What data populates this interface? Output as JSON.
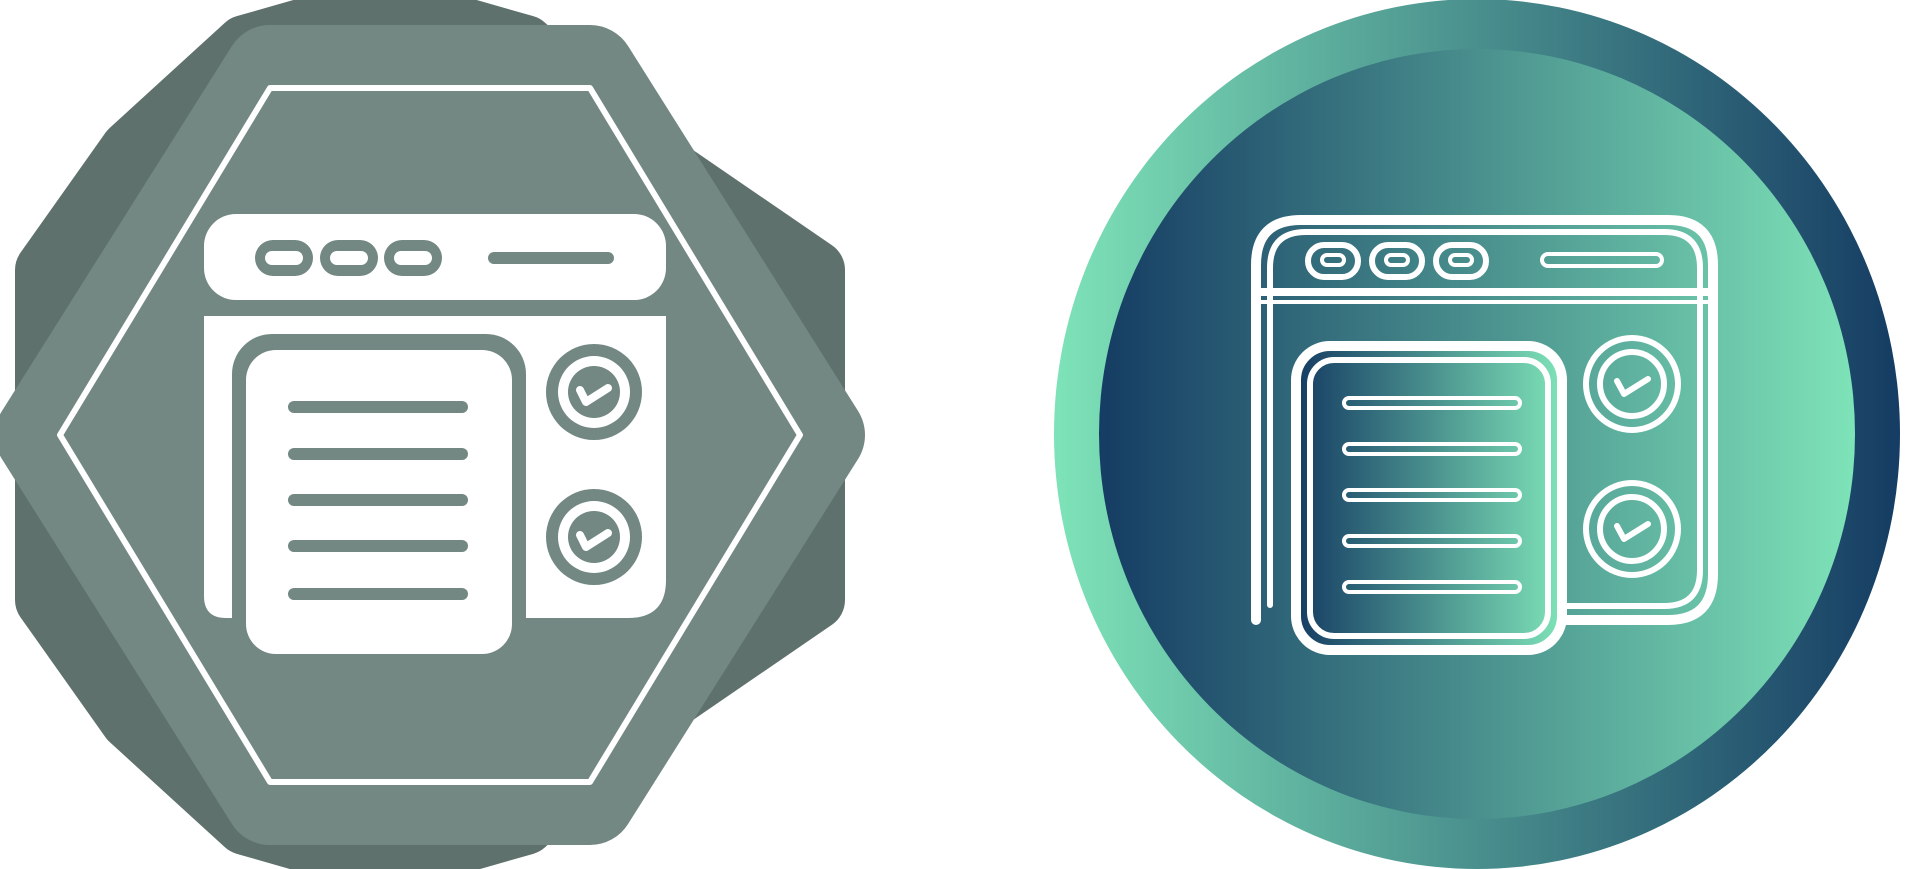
{
  "icons": [
    {
      "name": "browser-checklist-icon",
      "style": "glyph",
      "badge_shape": "octagon-badge",
      "colors": {
        "badge_outer": "#5f716c",
        "badge_inner": "#738883",
        "stroke": "#ffffff",
        "glyph_fill": "#ffffff",
        "glyph_detail": "#738883"
      }
    },
    {
      "name": "browser-checklist-icon",
      "style": "line",
      "badge_shape": "circle-badge",
      "colors": {
        "gradient_dark": "#153c63",
        "gradient_light": "#7ee3b8",
        "stroke": "#ffffff"
      }
    }
  ]
}
